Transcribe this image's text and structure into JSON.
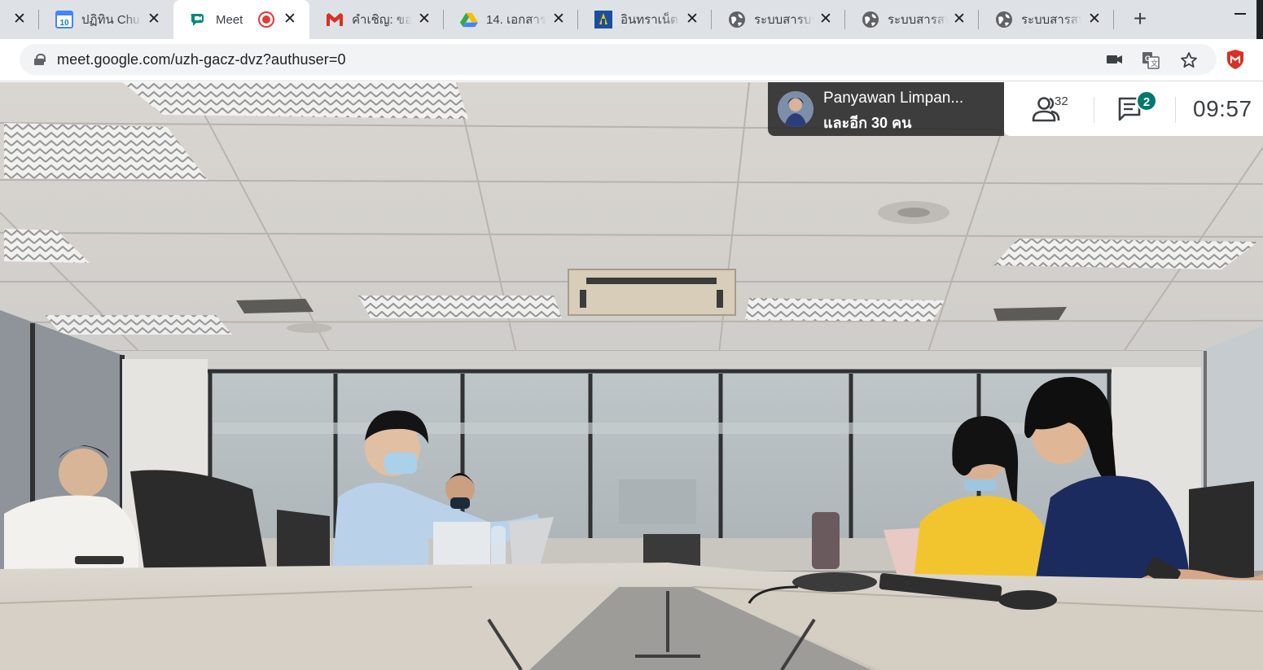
{
  "browser": {
    "tabs": [
      {
        "title": "",
        "favicon": "closed-tab-icon",
        "active": false
      },
      {
        "title": "ปฏิทิน Chu",
        "favicon": "google-calendar-icon",
        "badge": "10",
        "active": false
      },
      {
        "title": "Meet",
        "favicon": "google-meet-icon",
        "active": true,
        "recording": true
      },
      {
        "title": "คำเชิญ: ขอ",
        "favicon": "gmail-icon",
        "active": false
      },
      {
        "title": "14. เอกสาร",
        "favicon": "google-drive-icon",
        "active": false
      },
      {
        "title": "อินทราเน็ต",
        "favicon": "intranet-logo-icon",
        "active": false
      },
      {
        "title": "ระบบสารบร",
        "favicon": "globe-icon",
        "active": false
      },
      {
        "title": "ระบบสารสน",
        "favicon": "globe-icon",
        "active": false
      },
      {
        "title": "ระบบสารสน",
        "favicon": "globe-icon",
        "active": false
      }
    ],
    "new_tab_label": "+",
    "url": "meet.google.com/uzh-gacz-dvz?authuser=0",
    "toolbar_icons": [
      "camera-icon",
      "translate-icon",
      "bookmark-star-icon",
      "mcafee-extension-icon"
    ],
    "colors": {
      "tabstrip": "#dee1e6",
      "omnibox": "#f1f3f4",
      "accent_red": "#d93025"
    }
  },
  "meet": {
    "active_speaker": {
      "name": "Panyawan Limpan...",
      "others": "และอีก 30 คน"
    },
    "participants_count": "32",
    "chat_unread": "2",
    "clock": "09:57",
    "colors": {
      "badge": "#00796b",
      "overlay": "#282828"
    }
  },
  "video_feed": {
    "scene": "conference-room"
  }
}
